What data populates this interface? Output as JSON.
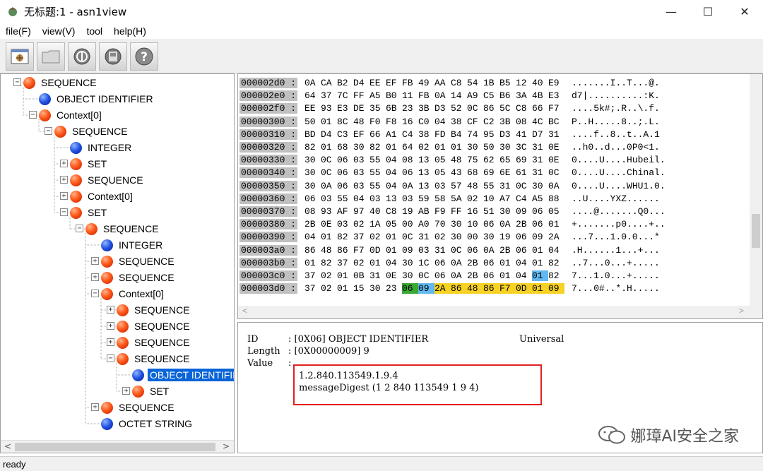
{
  "window": {
    "title": "无标题:1 - asn1view",
    "minimize": "—",
    "maximize": "☐",
    "close": "✕"
  },
  "menu": [
    "file(F)",
    "view(V)",
    "tool",
    "help(H)"
  ],
  "toolbar": {
    "buttons": [
      "open-file-icon",
      "folder-icon",
      "info-icon",
      "disk-icon",
      "help-icon"
    ]
  },
  "tree": {
    "nodes": [
      {
        "label": "SEQUENCE",
        "type": "red",
        "depth": 0,
        "expander": "-"
      },
      {
        "label": "OBJECT IDENTIFIER",
        "type": "blue",
        "depth": 1,
        "expander": ""
      },
      {
        "label": "Context[0]",
        "type": "red",
        "depth": 1,
        "expander": "-"
      },
      {
        "label": "SEQUENCE",
        "type": "red",
        "depth": 2,
        "expander": "-"
      },
      {
        "label": "INTEGER",
        "type": "blue",
        "depth": 3,
        "expander": ""
      },
      {
        "label": "SET",
        "type": "red",
        "depth": 3,
        "expander": "+"
      },
      {
        "label": "SEQUENCE",
        "type": "red",
        "depth": 3,
        "expander": "+"
      },
      {
        "label": "Context[0]",
        "type": "red",
        "depth": 3,
        "expander": "+"
      },
      {
        "label": "SET",
        "type": "red",
        "depth": 3,
        "expander": "-"
      },
      {
        "label": "SEQUENCE",
        "type": "red",
        "depth": 4,
        "expander": "-"
      },
      {
        "label": "INTEGER",
        "type": "blue",
        "depth": 5,
        "expander": ""
      },
      {
        "label": "SEQUENCE",
        "type": "red",
        "depth": 5,
        "expander": "+"
      },
      {
        "label": "SEQUENCE",
        "type": "red",
        "depth": 5,
        "expander": "+"
      },
      {
        "label": "Context[0]",
        "type": "red",
        "depth": 5,
        "expander": "-"
      },
      {
        "label": "SEQUENCE",
        "type": "red",
        "depth": 6,
        "expander": "+"
      },
      {
        "label": "SEQUENCE",
        "type": "red",
        "depth": 6,
        "expander": "+"
      },
      {
        "label": "SEQUENCE",
        "type": "red",
        "depth": 6,
        "expander": "+"
      },
      {
        "label": "SEQUENCE",
        "type": "red",
        "depth": 6,
        "expander": "-"
      },
      {
        "label": "OBJECT IDENTIFIER",
        "type": "blue",
        "depth": 7,
        "expander": "",
        "selected": true
      },
      {
        "label": "SET",
        "type": "red",
        "depth": 7,
        "expander": "+"
      },
      {
        "label": "SEQUENCE",
        "type": "red",
        "depth": 5,
        "expander": "+"
      },
      {
        "label": "OCTET STRING",
        "type": "blue",
        "depth": 5,
        "expander": ""
      }
    ]
  },
  "hex": {
    "rows": [
      {
        "addr": "000002d0 :",
        "bytes": [
          "0A",
          "CA",
          "B2",
          "D4",
          "EE",
          "EF",
          "FB",
          "49",
          "AA",
          "C8",
          "54",
          "1B",
          "B5",
          "12",
          "40",
          "E9"
        ],
        "ascii": ".......I..T...@."
      },
      {
        "addr": "000002e0 :",
        "bytes": [
          "64",
          "37",
          "7C",
          "FF",
          "A5",
          "B0",
          "11",
          "FB",
          "0A",
          "14",
          "A9",
          "C5",
          "B6",
          "3A",
          "4B",
          "E3"
        ],
        "ascii": "d7|..........:K."
      },
      {
        "addr": "000002f0 :",
        "bytes": [
          "EE",
          "93",
          "E3",
          "DE",
          "35",
          "6B",
          "23",
          "3B",
          "D3",
          "52",
          "0C",
          "86",
          "5C",
          "C8",
          "66",
          "F7"
        ],
        "ascii": "....5k#;.R..\\.f."
      },
      {
        "addr": "00000300 :",
        "bytes": [
          "50",
          "01",
          "8C",
          "48",
          "F0",
          "F8",
          "16",
          "C0",
          "04",
          "38",
          "CF",
          "C2",
          "3B",
          "08",
          "4C",
          "BC"
        ],
        "ascii": "P..H.....8..;.L."
      },
      {
        "addr": "00000310 :",
        "bytes": [
          "BD",
          "D4",
          "C3",
          "EF",
          "66",
          "A1",
          "C4",
          "38",
          "FD",
          "B4",
          "74",
          "95",
          "D3",
          "41",
          "D7",
          "31"
        ],
        "ascii": "....f..8..t..A.1"
      },
      {
        "addr": "00000320 :",
        "bytes": [
          "82",
          "01",
          "68",
          "30",
          "82",
          "01",
          "64",
          "02",
          "01",
          "01",
          "30",
          "50",
          "30",
          "3C",
          "31",
          "0E"
        ],
        "ascii": "..h0..d...0P0<1."
      },
      {
        "addr": "00000330 :",
        "bytes": [
          "30",
          "0C",
          "06",
          "03",
          "55",
          "04",
          "08",
          "13",
          "05",
          "48",
          "75",
          "62",
          "65",
          "69",
          "31",
          "0E"
        ],
        "ascii": "0....U....Hubeil."
      },
      {
        "addr": "00000340 :",
        "bytes": [
          "30",
          "0C",
          "06",
          "03",
          "55",
          "04",
          "06",
          "13",
          "05",
          "43",
          "68",
          "69",
          "6E",
          "61",
          "31",
          "0C"
        ],
        "ascii": "0....U....Chinal."
      },
      {
        "addr": "00000350 :",
        "bytes": [
          "30",
          "0A",
          "06",
          "03",
          "55",
          "04",
          "0A",
          "13",
          "03",
          "57",
          "48",
          "55",
          "31",
          "0C",
          "30",
          "0A"
        ],
        "ascii": "0....U....WHU1.0."
      },
      {
        "addr": "00000360 :",
        "bytes": [
          "06",
          "03",
          "55",
          "04",
          "03",
          "13",
          "03",
          "59",
          "58",
          "5A",
          "02",
          "10",
          "A7",
          "C4",
          "A5",
          "88"
        ],
        "ascii": "..U....YXZ......"
      },
      {
        "addr": "00000370 :",
        "bytes": [
          "08",
          "93",
          "AF",
          "97",
          "40",
          "C8",
          "19",
          "AB",
          "F9",
          "FF",
          "16",
          "51",
          "30",
          "09",
          "06",
          "05"
        ],
        "ascii": "....@.......Q0..."
      },
      {
        "addr": "00000380 :",
        "bytes": [
          "2B",
          "0E",
          "03",
          "02",
          "1A",
          "05",
          "00",
          "A0",
          "70",
          "30",
          "10",
          "06",
          "0A",
          "2B",
          "06",
          "01"
        ],
        "ascii": "+.......p0....+.."
      },
      {
        "addr": "00000390 :",
        "bytes": [
          "04",
          "01",
          "82",
          "37",
          "02",
          "01",
          "0C",
          "31",
          "02",
          "30",
          "00",
          "30",
          "19",
          "06",
          "09",
          "2A"
        ],
        "ascii": "...7...1.0.0...*"
      },
      {
        "addr": "000003a0 :",
        "bytes": [
          "86",
          "48",
          "86",
          "F7",
          "0D",
          "01",
          "09",
          "03",
          "31",
          "0C",
          "06",
          "0A",
          "2B",
          "06",
          "01",
          "04"
        ],
        "ascii": ".H......1...+..."
      },
      {
        "addr": "000003b0 :",
        "bytes": [
          "01",
          "82",
          "37",
          "02",
          "01",
          "04",
          "30",
          "1C",
          "06",
          "0A",
          "2B",
          "06",
          "01",
          "04",
          "01",
          "82"
        ],
        "ascii": "..7...0...+....."
      },
      {
        "addr": "000003c0 :",
        "bytes": [
          "37",
          "02",
          "01",
          "0B",
          "31",
          "0E",
          "30",
          "0C",
          "06",
          "0A",
          "2B",
          "06",
          "01",
          "04",
          "01",
          "82"
        ],
        "ascii": "7...1.0...+....."
      },
      {
        "addr": "000003d0 :",
        "bytes": [
          "37",
          "02",
          "01",
          "15",
          "30",
          "23",
          "06",
          "09",
          "2A",
          "86",
          "48",
          "86",
          "F7",
          "0D",
          "01",
          "09"
        ],
        "ascii": "7...0#..*.H....."
      }
    ]
  },
  "detail": {
    "id_label": "ID",
    "id_value": ": [0X06] OBJECT IDENTIFIER",
    "id_class": "Universal",
    "length_label": "Length",
    "length_value": ": [0X00000009] 9",
    "value_label": "Value",
    "value_colon": ":",
    "oid": "1.2.840.113549.1.9.4",
    "oid_name": "messageDigest (1 2 840 113549 1 9 4)"
  },
  "watermark": {
    "text": "娜璋AI安全之家"
  },
  "status": {
    "text": "ready"
  }
}
